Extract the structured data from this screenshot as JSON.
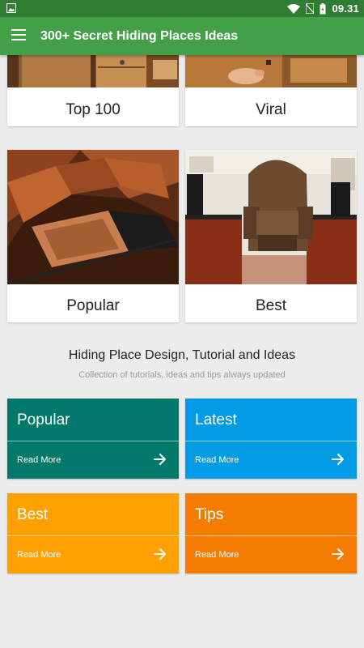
{
  "status_bar": {
    "time": "09.31",
    "icons": [
      "image-icon",
      "wifi-icon",
      "no-sim-icon",
      "battery-icon"
    ]
  },
  "app_bar": {
    "title": "300+ Secret Hiding Places Ideas",
    "menu_icon": "hamburger-menu-icon",
    "color": "#43a047",
    "status_color": "#2e7d32"
  },
  "cards": [
    {
      "label": "Top 100"
    },
    {
      "label": "Viral"
    },
    {
      "label": "Popular"
    },
    {
      "label": "Best"
    }
  ],
  "section": {
    "title": "Hiding Place Design, Tutorial and Ideas",
    "subtitle": "Collection of tutorials, ideas and tips always updated"
  },
  "tiles": [
    {
      "name": "Popular",
      "action": "Read More",
      "color": "#00796b"
    },
    {
      "name": "Latest",
      "action": "Read More",
      "color": "#039be5"
    },
    {
      "name": "Best",
      "action": "Read More",
      "color": "#ffa000"
    },
    {
      "name": "Tips",
      "action": "Read More",
      "color": "#f57c00"
    }
  ]
}
